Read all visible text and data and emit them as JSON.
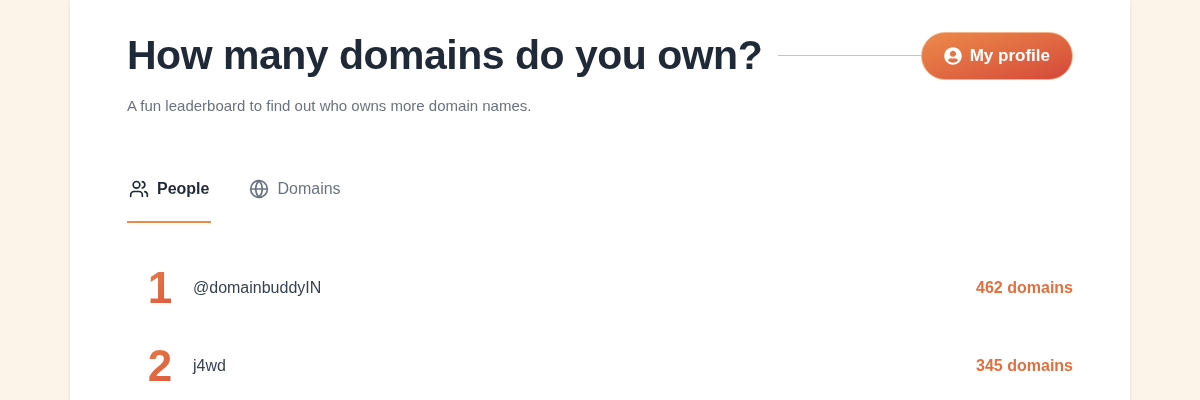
{
  "header": {
    "title": "How many domains do you own?",
    "subtitle": "A fun leaderboard to find out who owns more domain names.",
    "profile_button": "My profile"
  },
  "tabs": [
    {
      "label": "People",
      "selected": true
    },
    {
      "label": "Domains",
      "selected": false
    }
  ],
  "rows": [
    {
      "rank": "1",
      "name": "@domainbuddyIN",
      "count": "462 domains"
    },
    {
      "rank": "2",
      "name": "j4wd",
      "count": "345 domains"
    }
  ]
}
